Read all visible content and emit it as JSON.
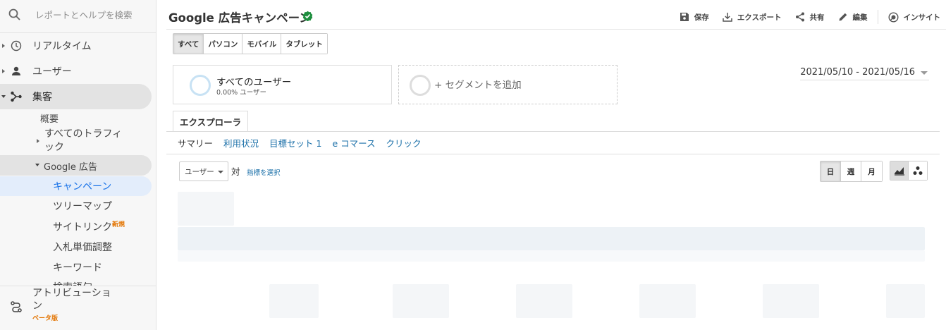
{
  "sidebar": {
    "search_placeholder": "レポートとヘルプを検索",
    "items": [
      {
        "label": "リアルタイム",
        "icon": "clock-icon"
      },
      {
        "label": "ユーザー",
        "icon": "person-icon"
      },
      {
        "label": "集客",
        "icon": "acquisition-icon"
      }
    ],
    "acquisition_children": {
      "overview": "概要",
      "all_traffic_line1": "すべてのトラフィ",
      "all_traffic_line2": "ック",
      "google_ads": "Google 広告",
      "ads_children": {
        "campaigns": "キャンペーン",
        "treemaps": "ツリーマップ",
        "sitelinks": "サイトリンク",
        "sitelinks_badge": "新規",
        "bid_adjustments": "入札単価調整",
        "keywords": "キーワード",
        "search_queries_partial": "検索語句"
      }
    },
    "attribution": {
      "label_line1": "アトリビューショ",
      "label_line2": "ン",
      "badge": "ベータ版",
      "icon": "attribution-icon"
    }
  },
  "header": {
    "title": "Google 広告キャンペーン",
    "actions": {
      "save": "保存",
      "export": "エクスポート",
      "share": "共有",
      "edit": "編集",
      "insights": "インサイト"
    }
  },
  "device_filter": [
    "すべて",
    "パソコン",
    "モバイル",
    "タブレット"
  ],
  "segments": {
    "active_name": "すべてのユーザー",
    "active_sub": "0.00% ユーザー",
    "add_label": "+ セグメントを追加"
  },
  "date_range": "2021/05/10 - 2021/05/16",
  "explorer_tab": "エクスプローラ",
  "subtabs": [
    "サマリー",
    "利用状況",
    "目標セット 1",
    "e コマース",
    "クリック"
  ],
  "chart_controls": {
    "metric": "ユーザー",
    "vs": "対",
    "choose_metric": "指標を選択",
    "periods": [
      "日",
      "週",
      "月"
    ]
  },
  "colors": {
    "accent_blue": "#1a6fa8",
    "verified_green": "#1e8e3e",
    "badge_orange": "#e37400",
    "segment_ring": "#c8e2f4"
  }
}
